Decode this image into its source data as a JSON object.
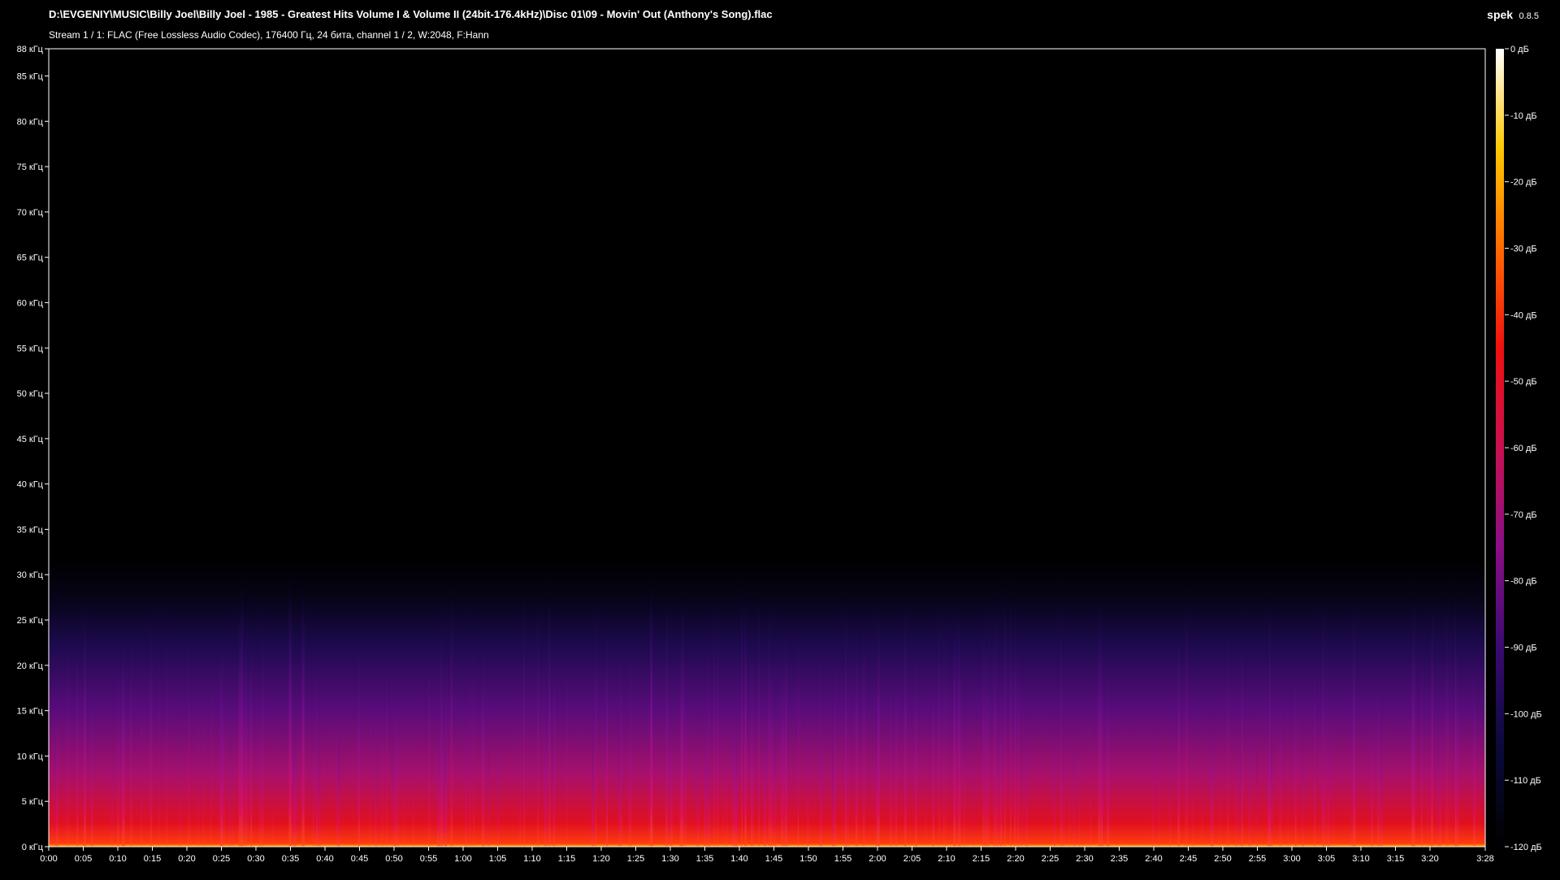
{
  "header": {
    "file_path": "D:\\EVGENIY\\MUSIC\\Billy Joel\\Billy Joel - 1985 - Greatest Hits Volume I & Volume II (24bit-176.4kHz)\\Disc 01\\09 - Movin' Out (Anthony's Song).flac",
    "stream_info": "Stream 1 / 1: FLAC (Free Lossless Audio Codec), 176400 Гц, 24 бита, channel 1 / 2, W:2048, F:Hann",
    "app_name": "spek",
    "app_version": "0.8.5"
  },
  "chart_data": {
    "type": "heatmap",
    "x_axis": {
      "unit": "time",
      "range_seconds": [
        0,
        208
      ],
      "tick_labels": [
        "0:00",
        "0:05",
        "0:10",
        "0:15",
        "0:20",
        "0:25",
        "0:30",
        "0:35",
        "0:40",
        "0:45",
        "0:50",
        "0:55",
        "1:00",
        "1:05",
        "1:10",
        "1:15",
        "1:20",
        "1:25",
        "1:30",
        "1:35",
        "1:40",
        "1:45",
        "1:50",
        "1:55",
        "2:00",
        "2:05",
        "2:10",
        "2:15",
        "2:20",
        "2:25",
        "2:30",
        "2:35",
        "2:40",
        "2:45",
        "2:50",
        "2:55",
        "3:00",
        "3:05",
        "3:10",
        "3:15",
        "3:20",
        "3:28"
      ]
    },
    "y_axis": {
      "unit": "кГц",
      "range": [
        0,
        88
      ],
      "tick_labels": [
        "0 кГц",
        "5 кГц",
        "10 кГц",
        "15 кГц",
        "20 кГц",
        "25 кГц",
        "30 кГц",
        "35 кГц",
        "40 кГц",
        "45 кГц",
        "50 кГц",
        "55 кГц",
        "60 кГц",
        "65 кГц",
        "70 кГц",
        "75 кГц",
        "80 кГц",
        "85 кГц",
        "88 кГц"
      ]
    },
    "colorbar": {
      "range_db": [
        -120,
        0
      ],
      "tick_labels": [
        "0 дБ",
        "-10 дБ",
        "-20 дБ",
        "-30 дБ",
        "-40 дБ",
        "-50 дБ",
        "-60 дБ",
        "-70 дБ",
        "-80 дБ",
        "-90 дБ",
        "-100 дБ",
        "-110 дБ",
        "-120 дБ"
      ],
      "colors": [
        "#000000",
        "#0a0a3c",
        "#3a0a72",
        "#8a0f86",
        "#c81050",
        "#f01010",
        "#ff6a00",
        "#ffc800",
        "#ffffff"
      ]
    },
    "spectral_cutoff_khz": 30
  }
}
